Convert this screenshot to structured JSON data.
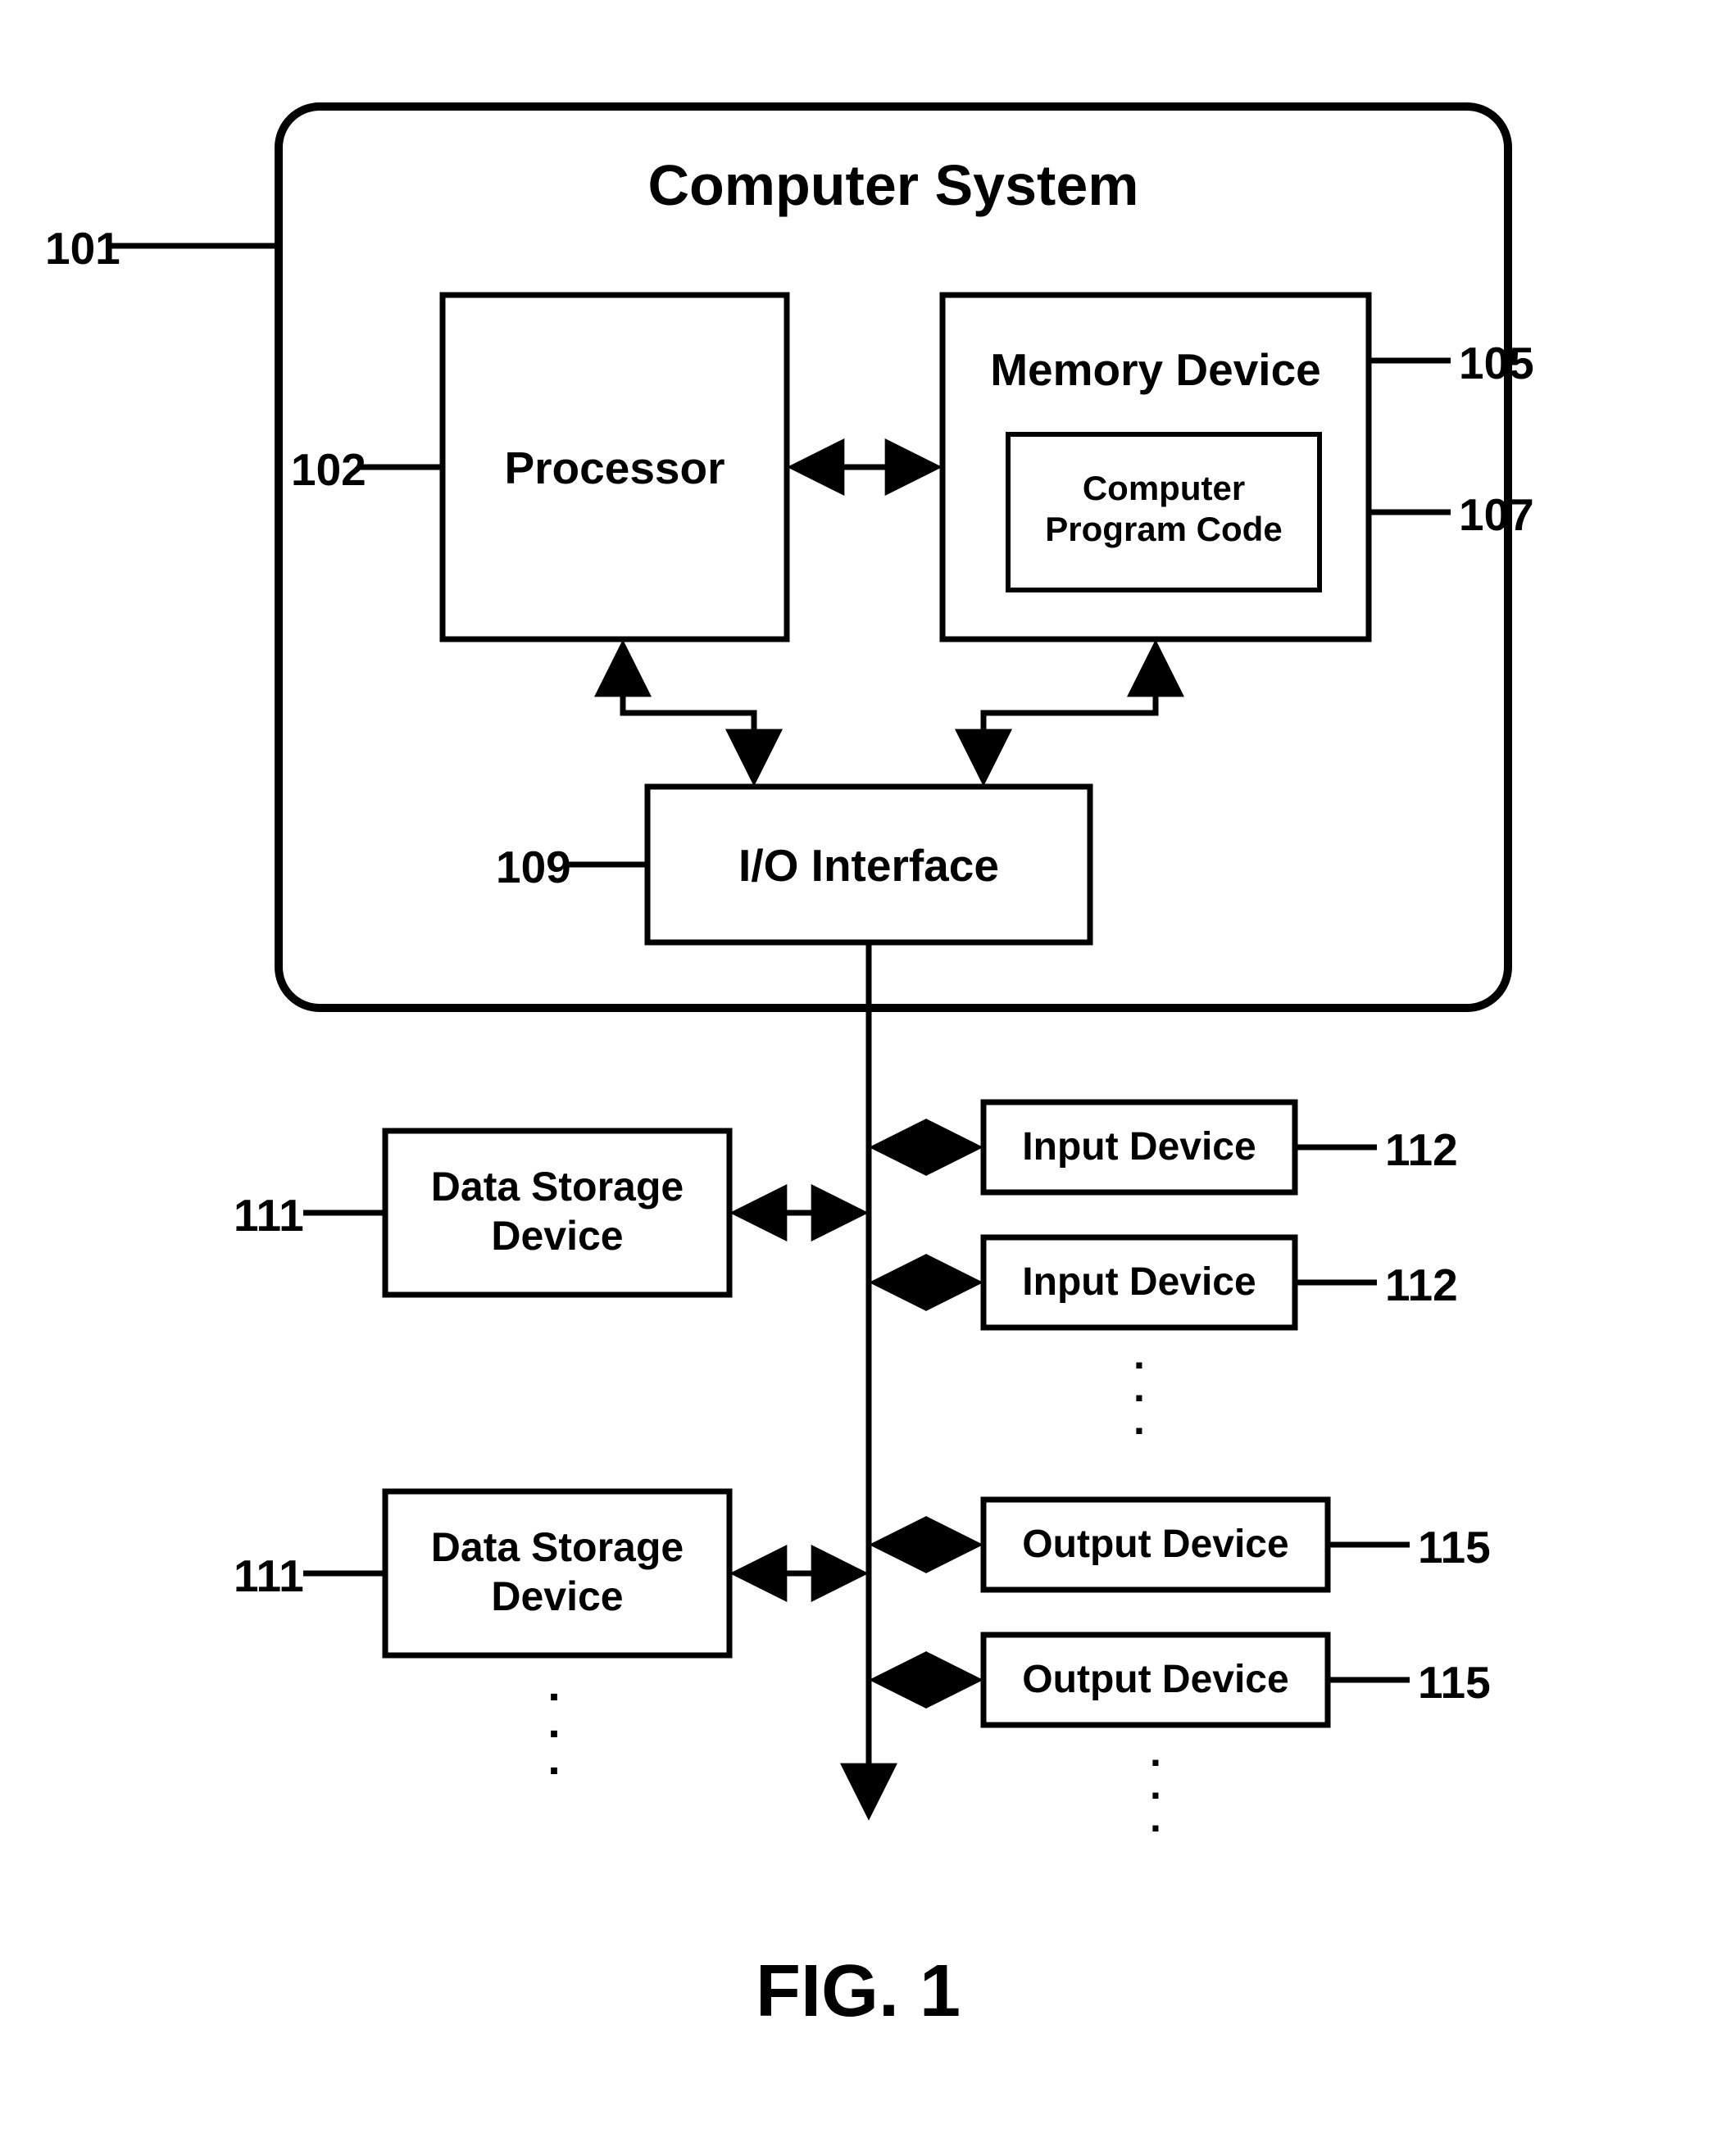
{
  "figure": {
    "caption": "FIG. 1"
  },
  "boxes": {
    "system": {
      "title": "Computer System",
      "ref": "101"
    },
    "processor": {
      "title": "Processor",
      "ref": "102"
    },
    "memory": {
      "title": "Memory Device",
      "ref": "105"
    },
    "code": {
      "title": "Computer\nProgram Code",
      "ref": "107"
    },
    "io": {
      "title": "I/O Interface",
      "ref": "109"
    },
    "storage1": {
      "title": "Data Storage\nDevice",
      "ref": "111"
    },
    "storage2": {
      "title": "Data Storage\nDevice",
      "ref": "111"
    },
    "input1": {
      "title": "Input Device",
      "ref": "112"
    },
    "input2": {
      "title": "Input Device",
      "ref": "112"
    },
    "output1": {
      "title": "Output Device",
      "ref": "115"
    },
    "output2": {
      "title": "Output Device",
      "ref": "115"
    }
  }
}
